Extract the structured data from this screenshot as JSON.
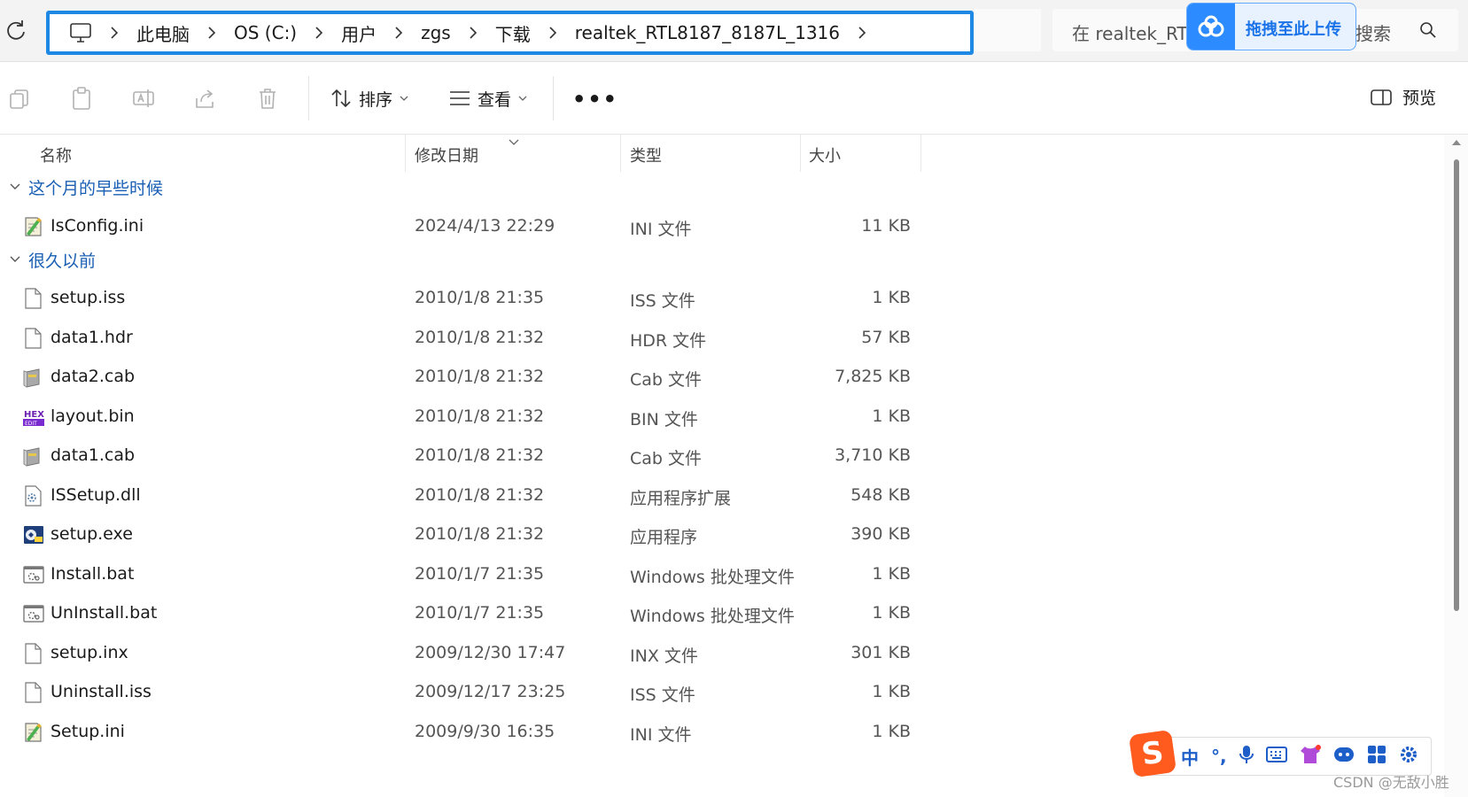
{
  "address": {
    "breadcrumbs": [
      "此电脑",
      "OS (C:)",
      "用户",
      "zgs",
      "下载",
      "realtek_RTL8187_8187L_1316"
    ],
    "search_placeholder": "在 realtek_RTL",
    "search_suffix": "搜索"
  },
  "baidu_overlay": {
    "label": "拖拽至此上传"
  },
  "toolbar": {
    "sort_label": "排序",
    "view_label": "查看",
    "more_label": "•••",
    "preview_label": "预览"
  },
  "columns": {
    "name": "名称",
    "date": "修改日期",
    "type": "类型",
    "size": "大小"
  },
  "groups": [
    {
      "label": "这个月的早些时候"
    },
    {
      "label": "很久以前"
    }
  ],
  "files": [
    {
      "name": "IsConfig.ini",
      "date": "2024/4/13 22:29",
      "type": "INI 文件",
      "size": "11 KB",
      "icon": "ini-icon"
    },
    {
      "name": "setup.iss",
      "date": "2010/1/8 21:35",
      "type": "ISS 文件",
      "size": "1 KB",
      "icon": "file-icon"
    },
    {
      "name": "data1.hdr",
      "date": "2010/1/8 21:32",
      "type": "HDR 文件",
      "size": "57 KB",
      "icon": "file-icon"
    },
    {
      "name": "data2.cab",
      "date": "2010/1/8 21:32",
      "type": "Cab 文件",
      "size": "7,825 KB",
      "icon": "cab-icon"
    },
    {
      "name": "layout.bin",
      "date": "2010/1/8 21:32",
      "type": "BIN 文件",
      "size": "1 KB",
      "icon": "hex-icon"
    },
    {
      "name": "data1.cab",
      "date": "2010/1/8 21:32",
      "type": "Cab 文件",
      "size": "3,710 KB",
      "icon": "cab-icon"
    },
    {
      "name": "ISSetup.dll",
      "date": "2010/1/8 21:32",
      "type": "应用程序扩展",
      "size": "548 KB",
      "icon": "dll-icon"
    },
    {
      "name": "setup.exe",
      "date": "2010/1/8 21:32",
      "type": "应用程序",
      "size": "390 KB",
      "icon": "exe-icon"
    },
    {
      "name": "Install.bat",
      "date": "2010/1/7 21:35",
      "type": "Windows 批处理文件",
      "size": "1 KB",
      "icon": "bat-icon"
    },
    {
      "name": "UnInstall.bat",
      "date": "2010/1/7 21:35",
      "type": "Windows 批处理文件",
      "size": "1 KB",
      "icon": "bat-icon"
    },
    {
      "name": "setup.inx",
      "date": "2009/12/30 17:47",
      "type": "INX 文件",
      "size": "301 KB",
      "icon": "file-icon"
    },
    {
      "name": "Uninstall.iss",
      "date": "2009/12/17 23:25",
      "type": "ISS 文件",
      "size": "1 KB",
      "icon": "file-icon"
    },
    {
      "name": "Setup.ini",
      "date": "2009/9/30 16:35",
      "type": "INI 文件",
      "size": "1 KB",
      "icon": "ini-icon"
    }
  ],
  "ime": {
    "mode": "中",
    "punct": "°,"
  },
  "watermark": "CSDN @无敌小胜"
}
